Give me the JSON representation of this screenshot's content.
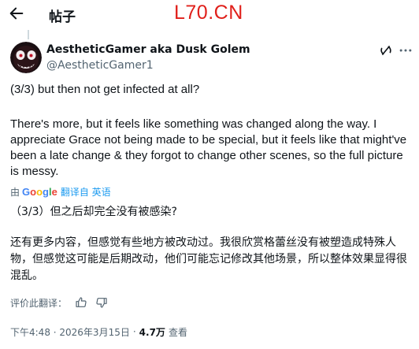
{
  "header": {
    "title": "帖子",
    "back_icon": "back-arrow-icon",
    "watermark": "L70.CN"
  },
  "author": {
    "name": "AestheticGamer aka Dusk Golem",
    "handle": "@AestheticGamer1",
    "avatar": "dark-creature-face-avatar",
    "grok_icon": "grok-icon",
    "more_icon": "more-icon"
  },
  "tweet": {
    "line1": "(3/3) but then not get infected at all?",
    "paragraph2": "There's more, but it feels like something was changed along the way. I appreciate Grace not being made to be special, but it feels like that might've been a late change & they forgot to change other scenes, so the full picture is messy."
  },
  "translation": {
    "by": "由",
    "provider": "Google",
    "link": "翻译自 英语",
    "line1": "（3/3）但之后却完全没有被感染?",
    "paragraph2": "还有更多内容，但感觉有些地方被改动过。我很欣赏格蕾丝没有被塑造成特殊人物，但感觉这可能是后期改动，他们可能忘记修改其他场景，所以整体效果显得很混乱。",
    "rate_label": "评价此翻译：",
    "thumbs_up_icon": "thumbs-up-icon",
    "thumbs_down_icon": "thumbs-down-icon"
  },
  "meta": {
    "time": "下午4:48 · 2026年3月15日",
    "separator": "·",
    "views": "4.7万",
    "views_label": "查看"
  },
  "colors": {
    "text": "#0f1419",
    "secondary": "#536471",
    "link": "#1d9bf0",
    "watermark": "#e0201b",
    "divider": "#cfd9de"
  }
}
